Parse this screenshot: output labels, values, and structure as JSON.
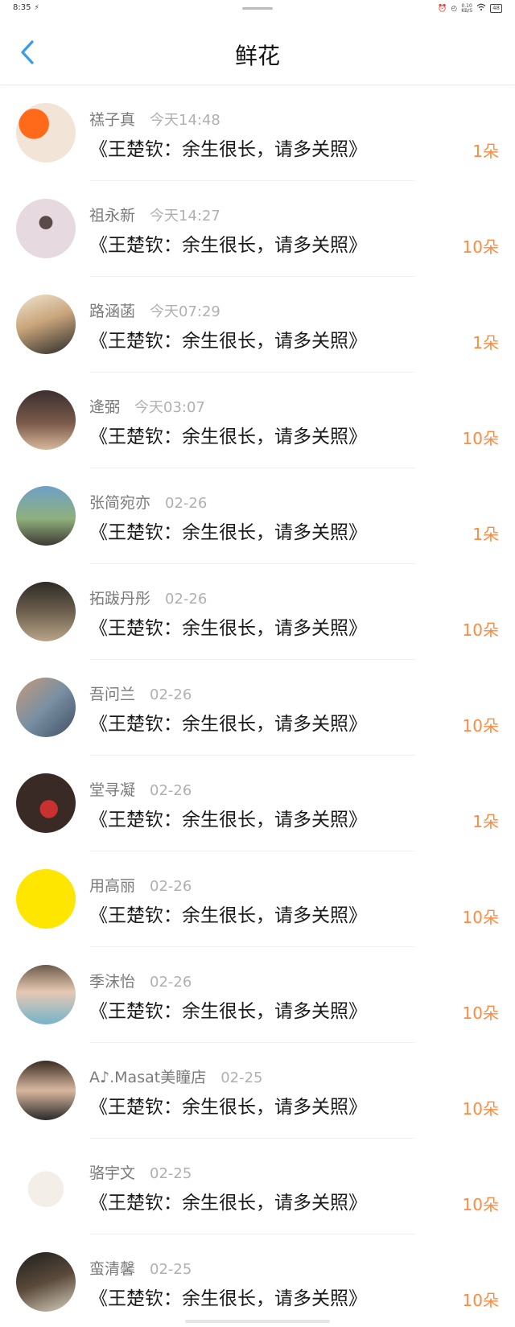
{
  "status_bar": {
    "time": "8:35",
    "time_extra": "⚡",
    "net_speed_top": "0.10",
    "net_speed_bottom": "KB/S",
    "battery": "48",
    "icons": [
      "alarm-icon",
      "clock-icon",
      "wifi-icon",
      "battery-icon"
    ]
  },
  "header": {
    "title": "鲜花",
    "back_icon": "chevron-left-icon",
    "accent_color": "#3a9bea"
  },
  "colors": {
    "count_color": "#ff8a3d",
    "name_color": "#7a7a7a",
    "time_color": "#b0b0b0"
  },
  "items": [
    {
      "name": "禚子真",
      "time": "今天14:48",
      "title": "《王楚钦：余生很长，请多关照》",
      "count": "1朵"
    },
    {
      "name": "祖永新",
      "time": "今天14:27",
      "title": "《王楚钦：余生很长，请多关照》",
      "count": "10朵"
    },
    {
      "name": "路涵菡",
      "time": "今天07:29",
      "title": "《王楚钦：余生很长，请多关照》",
      "count": "1朵"
    },
    {
      "name": "逄弼",
      "time": "今天03:07",
      "title": "《王楚钦：余生很长，请多关照》",
      "count": "10朵"
    },
    {
      "name": "张简宛亦",
      "time": "02-26",
      "title": "《王楚钦：余生很长，请多关照》",
      "count": "1朵"
    },
    {
      "name": "拓跋丹彤",
      "time": "02-26",
      "title": "《王楚钦：余生很长，请多关照》",
      "count": "10朵"
    },
    {
      "name": "吾问兰",
      "time": "02-26",
      "title": "《王楚钦：余生很长，请多关照》",
      "count": "10朵"
    },
    {
      "name": "堂寻凝",
      "time": "02-26",
      "title": "《王楚钦：余生很长，请多关照》",
      "count": "1朵"
    },
    {
      "name": "用高丽",
      "time": "02-26",
      "title": "《王楚钦：余生很长，请多关照》",
      "count": "10朵"
    },
    {
      "name": "季沫怡",
      "time": "02-26",
      "title": "《王楚钦：余生很长，请多关照》",
      "count": "10朵"
    },
    {
      "name": "A♪.Masat美瞳店",
      "time": "02-25",
      "title": "《王楚钦：余生很长，请多关照》",
      "count": "10朵"
    },
    {
      "name": "骆宇文",
      "time": "02-25",
      "title": "《王楚钦：余生很长，请多关照》",
      "count": "10朵"
    },
    {
      "name": "蛮清馨",
      "time": "02-25",
      "title": "《王楚钦：余生很长，请多关照》",
      "count": "10朵"
    }
  ]
}
